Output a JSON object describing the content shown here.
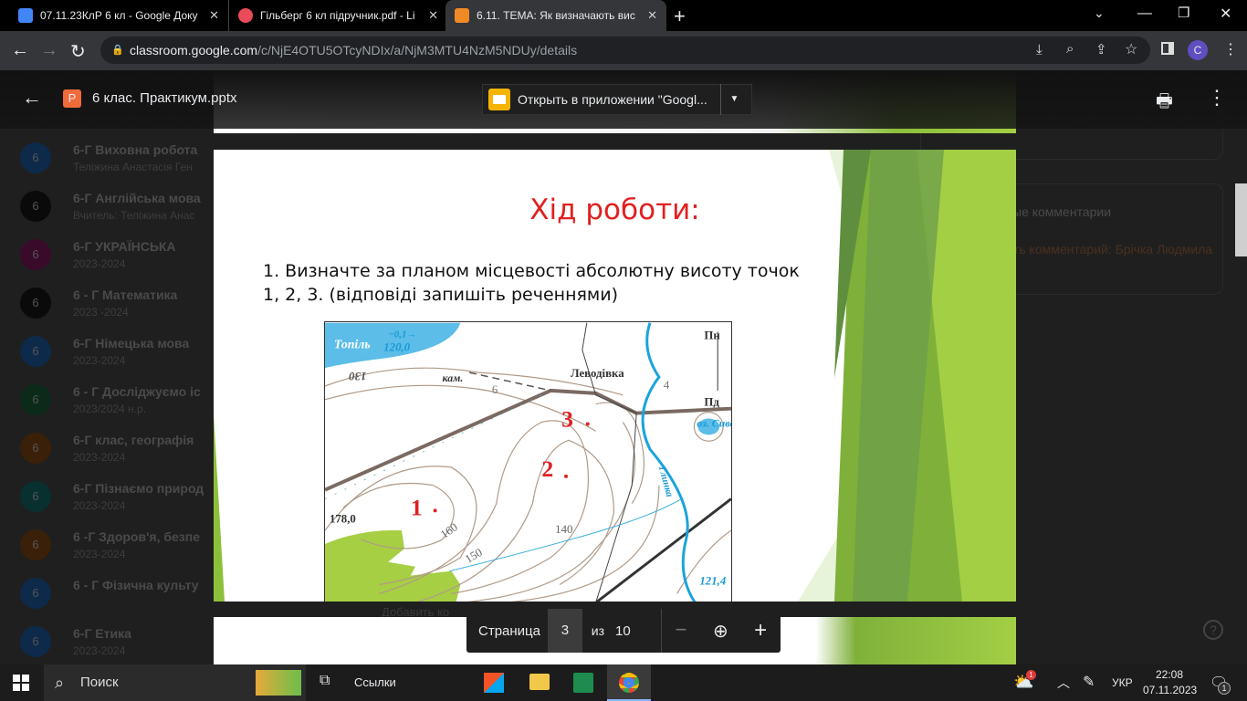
{
  "browser": {
    "tabs": [
      {
        "title": "07.11.23КлР 6 кл - Google Доку",
        "icon": "google-docs-icon",
        "color": "#4285f4"
      },
      {
        "title": "Гільберг 6 кл підручник.pdf - Li",
        "icon": "pdf-icon",
        "color": "#e94b5a"
      },
      {
        "title": "6.11. ТЕМА: Як визначають вис",
        "icon": "classroom-assignment-icon",
        "color": "#f08a24"
      }
    ],
    "url_domain": "classroom.google.com",
    "url_path": "/c/NjE4OTU5OTcyNDIx/a/NjM3MTU4NzM5NDUy/details",
    "profile_initial": "C"
  },
  "viewer": {
    "file_name": "6 клас. Практикум.pptx",
    "file_icon_letter": "P",
    "open_with": "Открыть в приложении \"Googl...",
    "page_label": "Страница",
    "page": "3",
    "of_label": "из",
    "total": "10"
  },
  "slide": {
    "title": "Хід роботи:",
    "line1": "1. Визначте за планом місцевості абсолютну висоту точок",
    "line2": "1, 2, 3. (відповіді запишіть реченнями)",
    "map": {
      "lake": "Топіль",
      "flow": "−0,1→",
      "h1": "120,0",
      "c130": "130",
      "kam": "кам.",
      "six": "6",
      "village": "Леводівка",
      "four": "4",
      "north": "Пн",
      "south": "Пд",
      "lake2": "оз. Сиве",
      "river": "Глинка",
      "h2": "178,0",
      "c160": "160",
      "c150": "150",
      "c140": "140",
      "h3": "121,4",
      "p1": "1",
      "p2": "2",
      "p3": "3"
    }
  },
  "background": {
    "courses": [
      {
        "name": "6-Г Виховна робота",
        "sub": "Теліжина Анастасія Ген",
        "color": "#0d2a4a"
      },
      {
        "name": "6-Г Англійська мова",
        "sub": "Вчитель: Теліжина Анас",
        "color": "#0a0a0a"
      },
      {
        "name": "6-Г УКРАЇНСЬКА",
        "sub": "2023-2024",
        "color": "#3a0a2a"
      },
      {
        "name": "6 - Г Математика",
        "sub": "2023 -2024",
        "color": "#0a0a0a"
      },
      {
        "name": "6-Г Німецька мова",
        "sub": "2023-2024",
        "color": "#0d2a4a"
      },
      {
        "name": "6 - Г Досліджуємо іс",
        "sub": "2023/2024 н.р.",
        "color": "#0b2a1a"
      },
      {
        "name": "6-Г клас, географія",
        "sub": "2023-2024",
        "color": "#3a2008"
      },
      {
        "name": "6-Г Пізнаємо природ",
        "sub": "2023-2024",
        "color": "#08302e"
      },
      {
        "name": "6 -Г Здоров'я, безпе",
        "sub": "2023-2024",
        "color": "#3a2008"
      },
      {
        "name": "6 - Г Фізична культу",
        "sub": "",
        "color": "#0d2a4a"
      },
      {
        "name": "6-Г Етика",
        "sub": "2023-2024",
        "color": "#0d2a4a"
      }
    ],
    "comments_title": "ые комментарии",
    "comment_link": "ть комментарий: Брічка Людмила",
    "add_comment": "Добавить ко"
  },
  "taskbar": {
    "search": "Поиск",
    "links": "Ссылки",
    "lang": "УКР",
    "time": "22:08",
    "date": "07.11.2023",
    "weather_badge": "1",
    "notif_badge": "1"
  }
}
